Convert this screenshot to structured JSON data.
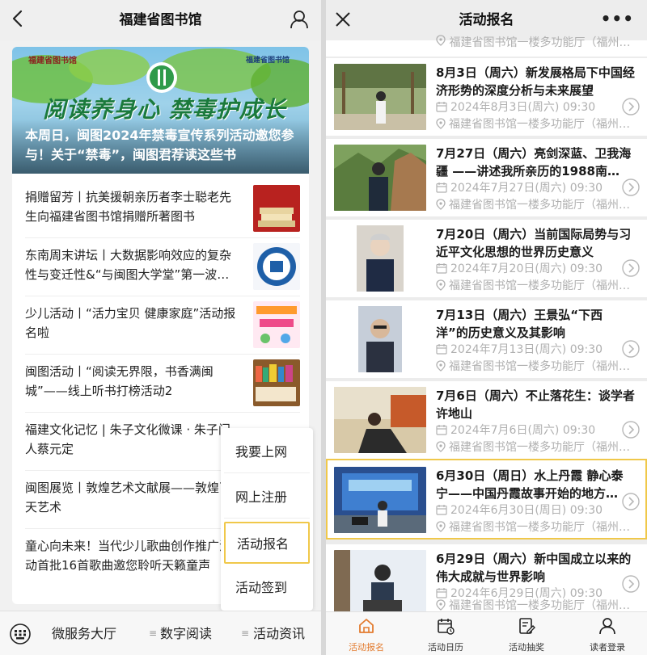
{
  "left": {
    "header": {
      "title": "福建省图书馆"
    },
    "banner": {
      "org_left": "福建省图书馆",
      "org_right": "福建省图书馆",
      "headline": "阅读养身心 禁毒护成长",
      "caption": "本周日，闽图2024年禁毒宣传系列活动邀您参与！关于“禁毒”，闽图君荐读这些书"
    },
    "articles": [
      {
        "text": "捐赠留芳丨抗美援朝亲历者李士聪老先生向福建省图书馆捐赠所著图书",
        "thumb": "books-thumb"
      },
      {
        "text": "东南周末讲坛丨大数据影响效应的复杂性与变迁性&“与闽图大学堂”第一波…",
        "thumb": "university-logo-thumb"
      },
      {
        "text": "少儿活动丨“活力宝贝 健康家庭”活动报名啦",
        "thumb": "kids-poster-thumb"
      },
      {
        "text": "闽图活动丨“阅读无界限，书香满闽城”——线上听书打榜活动2",
        "thumb": "bookshelf-thumb"
      },
      {
        "text": "福建文化记忆 | 朱子文化微课 · 朱子门人蔡元定",
        "thumb": ""
      },
      {
        "text": "闽图展览丨敦煌艺术文献展——敦煌飞天艺术",
        "thumb": ""
      },
      {
        "text": "童心向未来！当代少儿歌曲创作推广活动首批16首歌曲邀您聆听天籁童声",
        "thumb": ""
      }
    ],
    "popup_menu": [
      {
        "label": "我要上网",
        "active": false
      },
      {
        "label": "网上注册",
        "active": false
      },
      {
        "label": "活动报名",
        "active": true
      },
      {
        "label": "活动签到",
        "active": false
      }
    ],
    "bottom_tabs": [
      {
        "label": "微服务大厅"
      },
      {
        "label": "数字阅读"
      },
      {
        "label": "活动资讯"
      }
    ]
  },
  "right": {
    "header": {
      "title": "活动报名",
      "more": "•••"
    },
    "top_partial_location": "福建省图书馆一楼多功能厅（福州…",
    "events": [
      {
        "title": "8月3日（周六）新发展格局下中国经济形势的深度分析与未来展望",
        "date": "2024年8月3日(周六) 09:30",
        "location": "福建省图书馆一楼多功能厅（福州…",
        "selected": false
      },
      {
        "title": "7月27日（周六）亮剑深蓝、卫我海疆 ——讲述我所亲历的1988南…",
        "date": "2024年7月27日(周六) 09:30",
        "location": "福建省图书馆一楼多功能厅（福州…",
        "selected": false
      },
      {
        "title": "7月20日（周六）当前国际局势与习近平文化思想的世界历史意义",
        "date": "2024年7月20日(周六) 09:30",
        "location": "福建省图书馆一楼多功能厅（福州…",
        "selected": false
      },
      {
        "title": "7月13日（周六）王景弘“下西洋”的历史意义及其影响",
        "date": "2024年7月13日(周六) 09:30",
        "location": "福建省图书馆一楼多功能厅（福州…",
        "selected": false
      },
      {
        "title": "7月6日（周六）不止落花生：谈学者许地山",
        "date": "2024年7月6日(周六) 09:30",
        "location": "福建省图书馆一楼多功能厅（福州…",
        "selected": false
      },
      {
        "title": "6月30日（周日）水上丹霞 静心泰宁——中国丹霞故事开始的地方…",
        "date": "2024年6月30日(周日) 09:30",
        "location": "福建省图书馆一楼多功能厅（福州…",
        "selected": true
      },
      {
        "title": "6月29日（周六）新中国成立以来的伟大成就与世界影响",
        "date": "2024年6月29日(周六) 09:30",
        "location": "福建省图书馆一楼多功能厅（福州…",
        "selected": false
      }
    ],
    "tabbar": [
      {
        "label": "活动报名",
        "icon": "home-icon",
        "active": true
      },
      {
        "label": "活动日历",
        "icon": "calendar-icon",
        "active": false
      },
      {
        "label": "活动抽奖",
        "icon": "edit-icon",
        "active": false
      },
      {
        "label": "读者登录",
        "icon": "user-icon",
        "active": false
      }
    ]
  },
  "colors": {
    "accent_orange": "#e37b2e",
    "highlight_yellow": "#f0c84a",
    "banner_green": "#1b7a3c"
  }
}
